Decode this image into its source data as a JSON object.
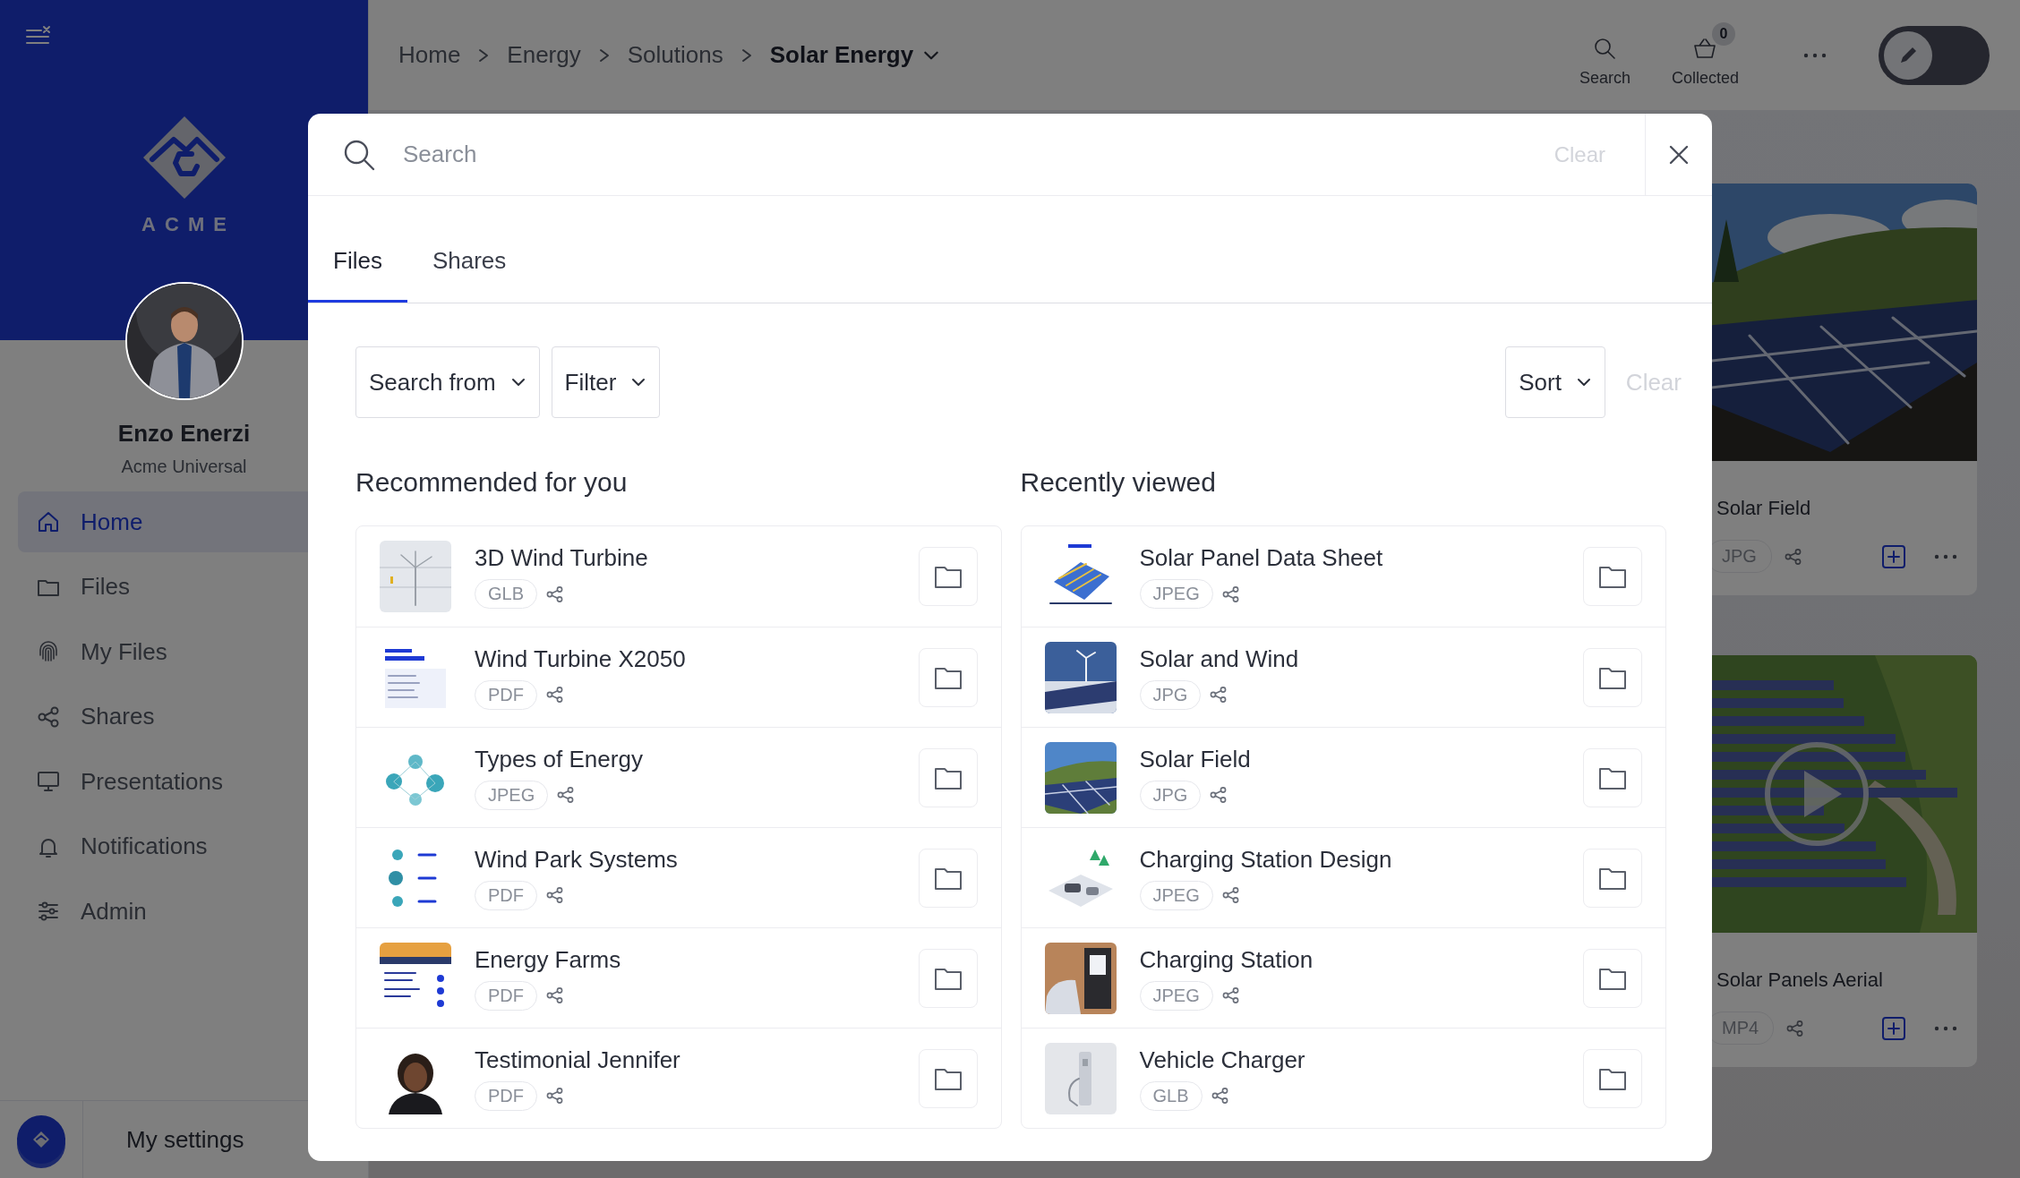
{
  "sidebar": {
    "logo_text": "ACME",
    "user": {
      "name": "Enzo Enerzi",
      "org": "Acme Universal"
    },
    "nav": [
      {
        "label": "Home",
        "selected": true
      },
      {
        "label": "Files",
        "selected": false
      },
      {
        "label": "My Files",
        "selected": false
      },
      {
        "label": "Shares",
        "selected": false
      },
      {
        "label": "Presentations",
        "selected": false
      },
      {
        "label": "Notifications",
        "selected": false
      },
      {
        "label": "Admin",
        "selected": false
      }
    ],
    "footer": {
      "label": "My settings"
    }
  },
  "header": {
    "breadcrumbs": [
      {
        "label": "Home",
        "current": false
      },
      {
        "label": "Energy",
        "current": false
      },
      {
        "label": "Solutions",
        "current": false
      },
      {
        "label": "Solar Energy",
        "current": true
      }
    ],
    "actions": [
      {
        "label": "Search"
      },
      {
        "label": "Collected",
        "badge": "0"
      }
    ],
    "edit_toggle": {
      "on": false
    }
  },
  "cards": [
    {
      "title": "Solar Field",
      "type": "JPG",
      "video": false
    },
    {
      "title": "Solar Panels Aerial",
      "type": "MP4",
      "video": true
    }
  ],
  "search_dialog": {
    "placeholder": "Search",
    "clear": {
      "label": "Clear",
      "disabled": true
    },
    "tabs": [
      {
        "label": "Files",
        "selected": true
      },
      {
        "label": "Shares",
        "selected": false
      }
    ],
    "filters": [
      {
        "label": "Search from"
      },
      {
        "label": "Filter"
      }
    ],
    "sort": {
      "label": "Sort"
    },
    "clear_filters": {
      "label": "Clear",
      "disabled": true
    },
    "sections": [
      {
        "title": "Recommended for you",
        "items": [
          {
            "title": "3D Wind Turbine",
            "type": "GLB"
          },
          {
            "title": "Wind Turbine X2050",
            "type": "PDF"
          },
          {
            "title": "Types of Energy",
            "type": "JPEG"
          },
          {
            "title": "Wind Park Systems",
            "type": "PDF"
          },
          {
            "title": "Energy Farms",
            "type": "PDF"
          },
          {
            "title": "Testimonial Jennifer",
            "type": "PDF"
          }
        ]
      },
      {
        "title": "Recently viewed",
        "items": [
          {
            "title": "Solar Panel Data Sheet",
            "type": "JPEG"
          },
          {
            "title": "Solar and Wind",
            "type": "JPG"
          },
          {
            "title": "Solar Field",
            "type": "JPG"
          },
          {
            "title": "Charging Station Design",
            "type": "JPEG"
          },
          {
            "title": "Charging Station",
            "type": "JPEG"
          },
          {
            "title": "Vehicle Charger",
            "type": "GLB"
          }
        ]
      }
    ]
  }
}
